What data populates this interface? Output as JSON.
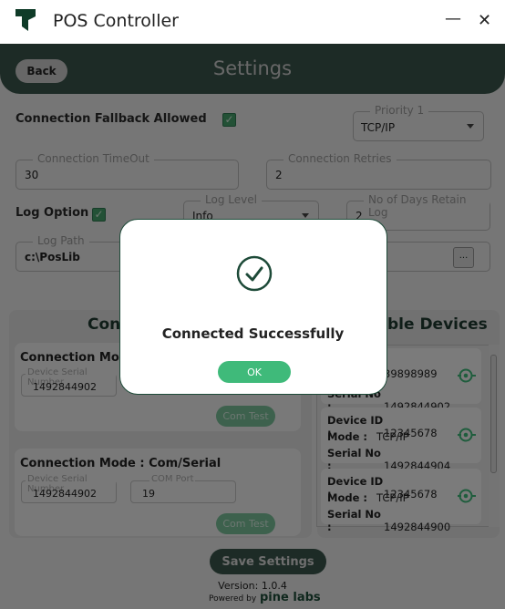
{
  "window": {
    "title": "POS Controller",
    "minimize_icon": "minimize-icon",
    "close_icon": "close-icon"
  },
  "header": {
    "back_label": "Back",
    "title": "Settings"
  },
  "general": {
    "fallback_label": "Connection Fallback Allowed",
    "fallback_checked": true,
    "priority1": {
      "legend": "Priority 1",
      "value": "TCP/IP"
    },
    "timeout": {
      "legend": "Connection TimeOut",
      "value": "30"
    },
    "retries": {
      "legend": "Connection Retries",
      "value": "2"
    },
    "log_option_label": "Log Option",
    "log_option_checked": true,
    "log_level": {
      "legend": "Log Level",
      "value": "Info"
    },
    "retain_days": {
      "legend": "No of Days Retain Log",
      "value": "2"
    },
    "log_path": {
      "legend": "Log Path",
      "value": "c:\\PosLib",
      "browse_label": "..."
    }
  },
  "connection_panel": {
    "title": "Conn",
    "cards": [
      {
        "title": "Connection Mode",
        "serial_legend": "Device Serial Number",
        "serial": "1492844902",
        "button": "Com Test"
      },
      {
        "title": "Connection Mode : Com/Serial",
        "serial_legend": "Device Serial Number",
        "serial": "1492844902",
        "port_legend": "COM Port",
        "port": "19",
        "button": "Com Test"
      }
    ]
  },
  "devices_panel": {
    "title": "ble Devices",
    "labels": {
      "id": "Device ID :",
      "mode": "Mode :",
      "serial": "Serial No :"
    },
    "devices": [
      {
        "id": "39898989",
        "mode": "",
        "serial": "1492844902"
      },
      {
        "id": "12345678",
        "mode": "TCP/IP",
        "serial": "1492844904"
      },
      {
        "id": "12345678",
        "mode": "TCP/IP",
        "serial": "1492844900"
      }
    ]
  },
  "footer": {
    "save_label": "Save Settings",
    "version": "Version:  1.0.4",
    "powered_by": "Powered by",
    "brand": "pine labs"
  },
  "dialog": {
    "icon": "check-circle-icon",
    "message": "Connected Successfully",
    "ok_label": "OK"
  },
  "colors": {
    "brand": "#3b574c",
    "accent": "#3fba7a",
    "dialog_border": "#1d4a38"
  }
}
